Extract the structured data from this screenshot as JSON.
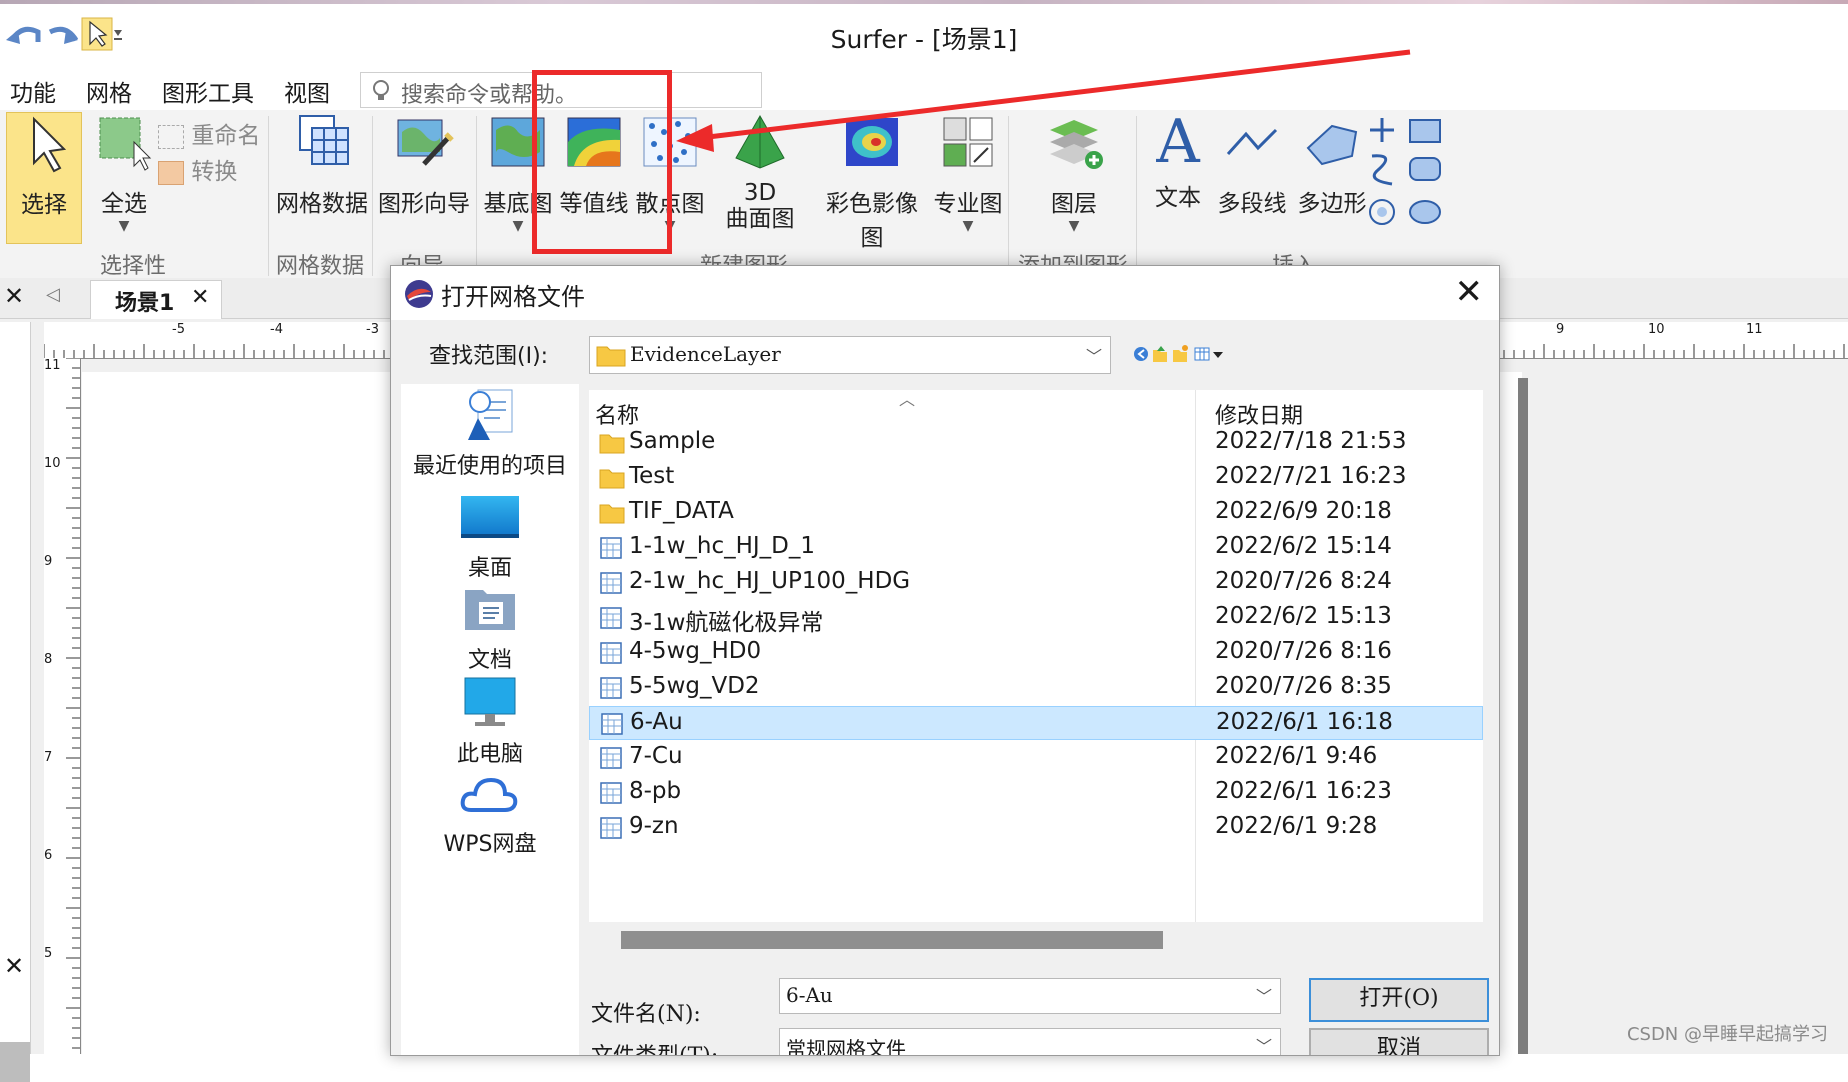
{
  "app": {
    "title": "Surfer - [场景1]"
  },
  "menu": {
    "items": [
      "功能",
      "网格",
      "图形工具",
      "视图"
    ],
    "search_placeholder": "搜索命令或帮助。"
  },
  "ribbon": {
    "select": "选择",
    "select_all": "全选",
    "rename": "重命名",
    "convert": "转换",
    "grid_data": "网格数据",
    "wizard": "图形向导",
    "base_map": "基底图",
    "contour": "等值线",
    "scatter": "散点图",
    "surface_3d_line1": "3D",
    "surface_3d_line2": "曲面图",
    "color_relief": "彩色影像图",
    "special": "专业图",
    "layers": "图层",
    "text": "文本",
    "polyline": "多段线",
    "polygon": "多边形",
    "groups": {
      "selection": "选择性",
      "grid": "网格数据",
      "wizard": "向导",
      "new_graph": "新建图形",
      "add_to_graph": "添加到图形",
      "insert": "插入"
    }
  },
  "tab": {
    "label": "场景1"
  },
  "ruler": {
    "h_ticks": [
      "-5",
      "-4",
      "-3",
      "9",
      "10",
      "11"
    ],
    "v_ticks": [
      "11",
      "10",
      "9",
      "8",
      "7",
      "6",
      "5"
    ]
  },
  "dialog": {
    "title": "打开网格文件",
    "look_in_label": "查找范围(I):",
    "look_in_value": "EvidenceLayer",
    "places": [
      "最近使用的项目",
      "桌面",
      "文档",
      "此电脑",
      "WPS网盘"
    ],
    "columns": {
      "name": "名称",
      "date": "修改日期"
    },
    "files": [
      {
        "name": "Sample",
        "date": "2022/7/18 21:53",
        "type": "folder"
      },
      {
        "name": "Test",
        "date": "2022/7/21 16:23",
        "type": "folder"
      },
      {
        "name": "TIF_DATA",
        "date": "2022/6/9 20:18",
        "type": "folder"
      },
      {
        "name": "1-1w_hc_HJ_D_1",
        "date": "2022/6/2 15:14",
        "type": "grid"
      },
      {
        "name": "2-1w_hc_HJ_UP100_HDG",
        "date": "2020/7/26 8:24",
        "type": "grid"
      },
      {
        "name": "3-1w航磁化极异常",
        "date": "2022/6/2 15:13",
        "type": "grid"
      },
      {
        "name": "4-5wg_HD0",
        "date": "2020/7/26 8:16",
        "type": "grid"
      },
      {
        "name": "5-5wg_VD2",
        "date": "2020/7/26 8:35",
        "type": "grid"
      },
      {
        "name": "6-Au",
        "date": "2022/6/1 16:18",
        "type": "grid",
        "selected": true
      },
      {
        "name": "7-Cu",
        "date": "2022/6/1 9:46",
        "type": "grid"
      },
      {
        "name": "8-pb",
        "date": "2022/6/1 16:23",
        "type": "grid"
      },
      {
        "name": "9-zn",
        "date": "2022/6/1 9:28",
        "type": "grid"
      }
    ],
    "filename_label": "文件名(N):",
    "filename_value": "6-Au",
    "filetype_label": "文件类型(T):",
    "filetype_value": "常规网格文件",
    "open_button": "打开(O)",
    "cancel_button": "取消"
  },
  "watermark": "CSDN @早睡早起搞学习",
  "colors": {
    "accent": "#3c8fd9",
    "selection": "#cce8ff",
    "annotation": "#ec2a2a",
    "select_btn": "#fbe48a"
  }
}
